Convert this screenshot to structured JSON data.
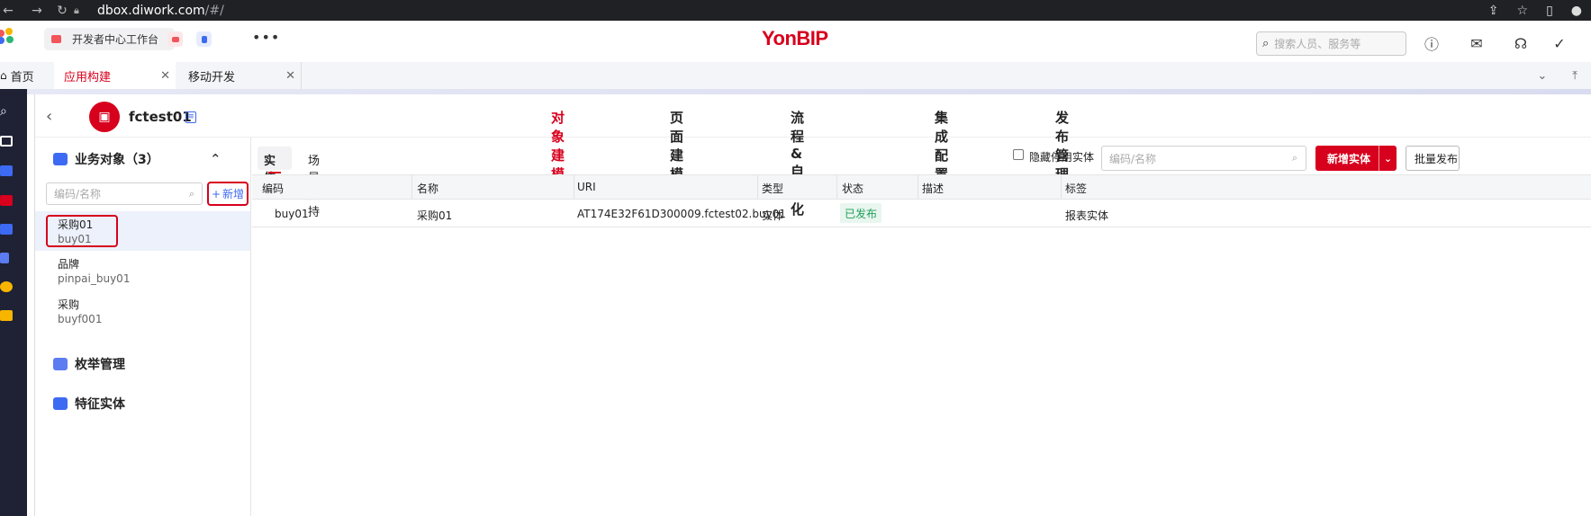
{
  "browser": {
    "url_host": "dbox.diwork.com",
    "url_path": "/#/"
  },
  "header": {
    "workbench_tab": "开发者中心工作台",
    "brand": "YonBIP",
    "search_placeholder": "搜索人员、服务等"
  },
  "tabs": [
    {
      "label": "首页"
    },
    {
      "label": "应用构建"
    },
    {
      "label": "移动开发"
    }
  ],
  "app": {
    "name": "fctest01"
  },
  "main_nav": [
    {
      "label": "对象建模",
      "active": true
    },
    {
      "label": "页面建模",
      "active": false
    },
    {
      "label": "流程&自动化",
      "active": false
    },
    {
      "label": "集成配置",
      "active": false
    },
    {
      "label": "发布管理",
      "active": false
    }
  ],
  "tree": {
    "group_business": "业务对象（3）",
    "search_placeholder": "编码/名称",
    "add_label": "新增",
    "items": [
      {
        "name": "采购01",
        "code": "buy01"
      },
      {
        "name": "品牌",
        "code": "pinpai_buy01"
      },
      {
        "name": "采购",
        "code": "buyf001"
      }
    ],
    "group_enum": "枚举管理",
    "group_feature": "特征实体"
  },
  "content": {
    "sub_tabs": [
      "实体",
      "场景支持"
    ],
    "hide_disabled_label": "隐藏停用实体",
    "search_placeholder": "编码/名称",
    "new_entity_label": "新增实体",
    "batch_publish_label": "批量发布"
  },
  "table": {
    "columns": [
      "编码",
      "名称",
      "URI",
      "类型",
      "状态",
      "描述",
      "标签"
    ],
    "rows": [
      {
        "code": "buy01",
        "name": "采购01",
        "uri": "AT174E32F61D300009.fctest02.buy01",
        "type": "实体",
        "status": "已发布",
        "desc": "",
        "tag": "报表实体"
      }
    ]
  },
  "colors": {
    "brand_red": "#d7001d",
    "accent_blue": "#3d6af2",
    "status_green": "#20a05a"
  }
}
